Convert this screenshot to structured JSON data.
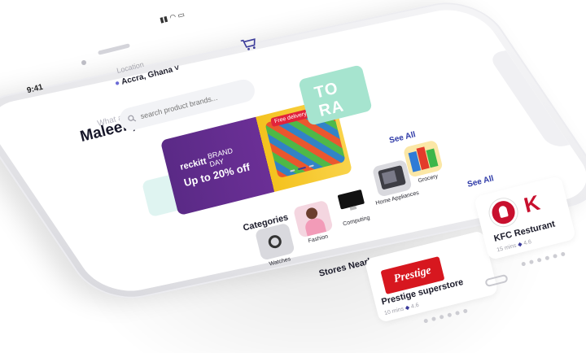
{
  "status": {
    "time": "9:41",
    "icons": "▮▮ ◠ ▭"
  },
  "header": {
    "location_label": "Location",
    "location_value": "Accra, Ghana",
    "location_chevron": "˅"
  },
  "greeting": {
    "name": "Maleek,",
    "subtitle": "What are you buying today?"
  },
  "search": {
    "placeholder": "search product brands..."
  },
  "banner": {
    "brand": "reckitt",
    "event_line1": "BRAND",
    "event_line2": "DAY",
    "offer": "Up to 20% off",
    "tag": "Free delivery"
  },
  "banner2": {
    "text": "TO RA"
  },
  "sections": {
    "categories_title": "Categories",
    "see_all": "See All",
    "stores_title": "Stores Nearby"
  },
  "categories": [
    {
      "label": "Watches"
    },
    {
      "label": "Fashion"
    },
    {
      "label": "Computing"
    },
    {
      "label": "Home Appliances"
    },
    {
      "label": "Grocery"
    }
  ],
  "stores": [
    {
      "name": "Prestige superstore",
      "logo_text": "Prestige",
      "distance": "10 mins",
      "rating": "4.6"
    },
    {
      "name": "KFC Resturant",
      "logo_text": "K",
      "distance": "15 mins",
      "rating": "4.6"
    }
  ],
  "icons": {
    "cart": "cart-icon",
    "search": "search-icon",
    "location": "pin-icon"
  },
  "colors": {
    "accent": "#2e3aa8",
    "banner_purple": "#5a2a86",
    "banner_yellow": "#f4c21e",
    "prestige_red": "#d7171f",
    "kfc_red": "#c8102e"
  }
}
